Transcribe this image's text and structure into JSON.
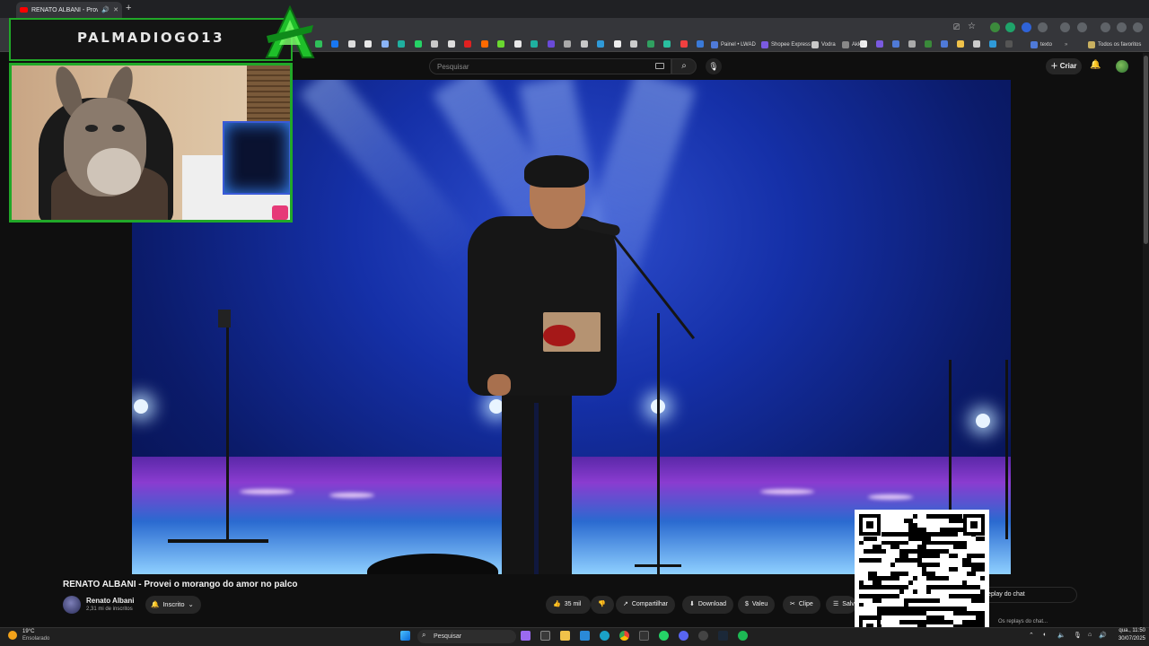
{
  "browser": {
    "tab_title": "RENATO ALBANI - Provei o",
    "new_tab_label": "+",
    "bookmarks": [
      {
        "label": "Painel • LWAD",
        "color": "#4f7ad8"
      },
      {
        "label": "Shopee Express",
        "color": "#7a5ae0"
      },
      {
        "label": "Vodra",
        "color": "#c8c8c8"
      },
      {
        "label": "Akko",
        "color": "#888888"
      },
      {
        "label": "texto",
        "color": "#4f7ad8"
      },
      {
        "label": "Todos os favoritos",
        "color": "#c8b060"
      }
    ]
  },
  "youtube": {
    "search_placeholder": "Pesquisar",
    "create_label": "Criar",
    "create_icon": "plus-icon",
    "video_title": "RENATO ALBANI - Provei o morango do amor no palco",
    "channel_name": "Renato Albani",
    "channel_subs": "2,31 mi de inscritos",
    "subscribed_label": "Inscrito",
    "actions": [
      {
        "name": "like-button",
        "icon": "👍",
        "label": "35 mil"
      },
      {
        "name": "dislike-button",
        "icon": "👎",
        "label": ""
      },
      {
        "name": "share-button",
        "icon": "↗",
        "label": "Compartilhar"
      },
      {
        "name": "download-button",
        "icon": "⬇",
        "label": "Download"
      },
      {
        "name": "thanks-button",
        "icon": "$",
        "label": "Valeu"
      },
      {
        "name": "clip-button",
        "icon": "✂",
        "label": "Clipe"
      },
      {
        "name": "save-button",
        "icon": "☰",
        "label": "Salvar"
      }
    ],
    "chat_replay_label": "Replay do chat",
    "chat_hint": "Os replays do chat..."
  },
  "overlay": {
    "streamer_name": "PALMADIOGO13",
    "accent_color": "#21a828"
  },
  "taskbar": {
    "weather_temp": "19°C",
    "weather_desc": "Ensolarado",
    "search_label": "Pesquisar",
    "time": "qua., 11:50",
    "date": "30/07/2025"
  }
}
